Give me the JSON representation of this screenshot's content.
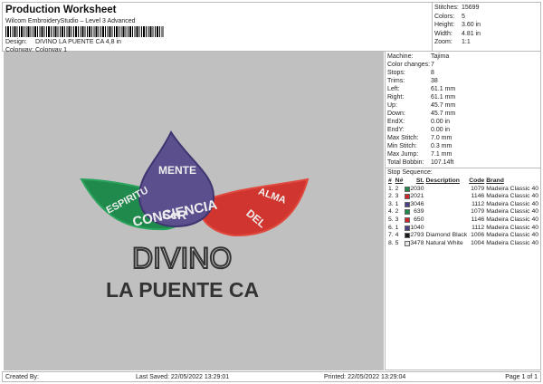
{
  "header": {
    "title": "Production Worksheet",
    "subtitle": "Wilcom EmbroideryStudio – Level 3 Advanced",
    "design_label": "Design:",
    "design_value": "DIVINO LA PUENTE CA 4,8 in",
    "colorway_label": "Colorway:",
    "colorway_value": "Colorway 1"
  },
  "stats": [
    {
      "label": "Stitches:",
      "value": "15699"
    },
    {
      "label": "Colors:",
      "value": "5"
    },
    {
      "label": "Height:",
      "value": "3.60 in"
    },
    {
      "label": "Width:",
      "value": "4.81 in"
    },
    {
      "label": "Zoom:",
      "value": "1:1"
    }
  ],
  "machine": [
    {
      "label": "Machine:",
      "value": "Tajima"
    },
    {
      "label": "Color changes:",
      "value": "7"
    },
    {
      "label": "Stops:",
      "value": "8"
    },
    {
      "label": "Trims:",
      "value": "38"
    },
    {
      "label": "Left:",
      "value": "61.1 mm"
    },
    {
      "label": "Right:",
      "value": "61.1 mm"
    },
    {
      "label": "Up:",
      "value": "45.7 mm"
    },
    {
      "label": "Down:",
      "value": "45.7 mm"
    },
    {
      "label": "EndX:",
      "value": "0.00 in"
    },
    {
      "label": "EndY:",
      "value": "0.00 in"
    },
    {
      "label": "Max Stitch:",
      "value": "7.0 mm"
    },
    {
      "label": "Min Stitch:",
      "value": "0.3 mm"
    },
    {
      "label": "Max Jump:",
      "value": "7.1 mm"
    },
    {
      "label": "Total Bobbin:",
      "value": "107.14ft"
    }
  ],
  "stop_sequence": {
    "title": "Stop Sequence:",
    "headers": [
      "#",
      "N#",
      "St.",
      "Description",
      "Code",
      "Brand"
    ],
    "rows": [
      {
        "n": "1.",
        "needle": "2",
        "color": "#1f8a4c",
        "st": "2030",
        "desc": "",
        "code": "1079",
        "brand": "Madeira Classic 40"
      },
      {
        "n": "2.",
        "needle": "3",
        "color": "#d0262b",
        "st": "2021",
        "desc": "",
        "code": "1146",
        "brand": "Madeira Classic 40"
      },
      {
        "n": "3.",
        "needle": "1",
        "color": "#4e3f86",
        "st": "3046",
        "desc": "",
        "code": "1112",
        "brand": "Madeira Classic 40"
      },
      {
        "n": "4.",
        "needle": "2",
        "color": "#1f8a4c",
        "st": "639",
        "desc": "",
        "code": "1079",
        "brand": "Madeira Classic 40"
      },
      {
        "n": "5.",
        "needle": "3",
        "color": "#d0262b",
        "st": "650",
        "desc": "",
        "code": "1146",
        "brand": "Madeira Classic 40"
      },
      {
        "n": "6.",
        "needle": "1",
        "color": "#4e3f86",
        "st": "1040",
        "desc": "",
        "code": "1112",
        "brand": "Madeira Classic 40"
      },
      {
        "n": "7.",
        "needle": "4",
        "color": "#1a1a1a",
        "st": "2793",
        "desc": "Diamond Black",
        "code": "1006",
        "brand": "Madeira Classic 40"
      },
      {
        "n": "8.",
        "needle": "5",
        "color": "#e8e8e8",
        "st": "3478",
        "desc": "Natural White",
        "code": "1004",
        "brand": "Madeira Classic 40"
      }
    ]
  },
  "design_art": {
    "mente": "MENTE",
    "espiritu": "ESPIRITU",
    "alma": "ALMA",
    "del": "DEL",
    "conciencia": "CONCIENCIA",
    "ser": "SeR",
    "divino": "DIVINO",
    "la_puente": "LA PUENTE CA"
  },
  "footer": {
    "created_by": "Created By:",
    "last_saved": "Last Saved: 22/05/2022 13:29:01",
    "printed": "Printed: 22/05/2022 13:29:04",
    "page": "Page 1 of 1"
  }
}
